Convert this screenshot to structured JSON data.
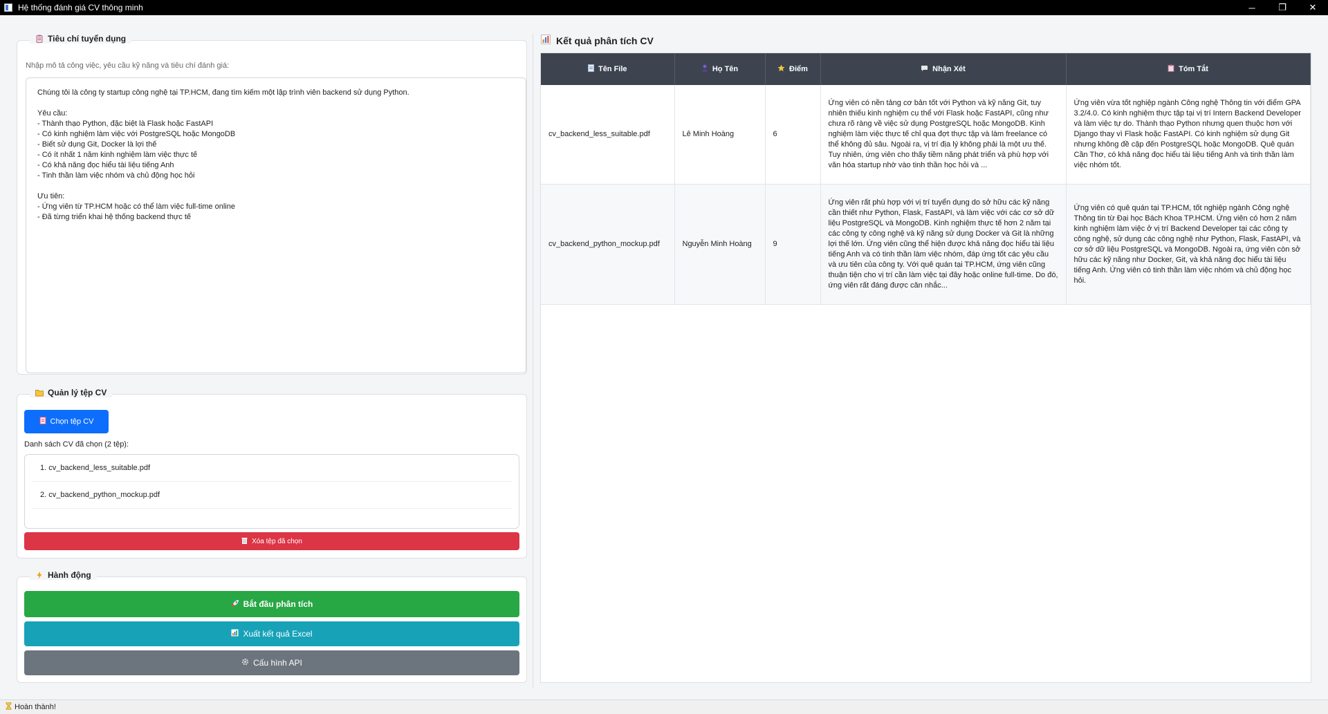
{
  "window": {
    "title": "Hệ thống đánh giá CV thông minh",
    "minimize": "─",
    "restore": "❐",
    "close": "✕"
  },
  "criteria": {
    "group_title": "Tiêu chí tuyển dụng",
    "hint": "Nhập mô tả công việc, yêu cầu kỹ năng và tiêu chí đánh giá:",
    "text": "Chúng tôi là công ty startup công nghệ tại TP.HCM, đang tìm kiếm một lập trình viên backend sử dụng Python.\n\nYêu cầu:\n- Thành thạo Python, đặc biệt là Flask hoặc FastAPI\n- Có kinh nghiệm làm việc với PostgreSQL hoặc MongoDB\n- Biết sử dụng Git, Docker là lợi thế\n- Có ít nhất 1 năm kinh nghiệm làm việc thực tế\n- Có khả năng đọc hiểu tài liệu tiếng Anh\n- Tinh thần làm việc nhóm và chủ động học hỏi\n\nƯu tiên:\n- Ứng viên từ TP.HCM hoặc có thể làm việc full-time online\n- Đã từng triển khai hệ thống backend thực tế"
  },
  "files": {
    "group_title": "Quản lý tệp CV",
    "choose_label": "Chọn tệp CV",
    "list_label": "Danh sách CV đã chọn (2 tệp):",
    "items": [
      "1. cv_backend_less_suitable.pdf",
      "2. cv_backend_python_mockup.pdf"
    ],
    "delete_label": "Xóa tệp đã chọn"
  },
  "actions": {
    "group_title": "Hành động",
    "start_label": "Bắt đầu phân tích",
    "export_label": "Xuất kết quả Excel",
    "config_label": "Cấu hình API"
  },
  "results": {
    "title": "Kết quả phân tích CV",
    "columns": [
      "Tên File",
      "Họ Tên",
      "Điểm",
      "Nhận Xét",
      "Tóm Tắt"
    ],
    "rows": [
      {
        "file": "cv_backend_less_suitable.pdf",
        "name": "Lê Minh Hoàng",
        "score": "6",
        "comment": "Ứng viên có nền tảng cơ bản tốt với Python và kỹ năng Git, tuy nhiên thiếu kinh nghiệm cụ thể với Flask hoặc FastAPI, cũng như chưa rõ ràng về việc sử dụng PostgreSQL hoặc MongoDB. Kinh nghiệm làm việc thực tế chỉ qua đợt thực tập và làm freelance có thể không đủ sâu. Ngoài ra, vị trí địa lý không phải là một ưu thế. Tuy nhiên, ứng viên cho thấy tiềm năng phát triển và phù hợp với văn hóa startup nhờ vào tinh thần học hỏi và ...",
        "summary": "Ứng viên vừa tốt nghiệp ngành Công nghệ Thông tin với điểm GPA 3.2/4.0. Có kinh nghiệm thực tập tại vị trí Intern Backend Developer và làm việc tự do. Thành thạo Python nhưng quen thuộc hơn với Django thay vì Flask hoặc FastAPI. Có kinh nghiệm sử dụng Git nhưng không đề cập đến PostgreSQL hoặc MongoDB. Quê quán Cần Thơ, có khả năng đọc hiểu tài liệu tiếng Anh và tinh thần làm việc nhóm tốt."
      },
      {
        "file": "cv_backend_python_mockup.pdf",
        "name": "Nguyễn Minh Hoàng",
        "score": "9",
        "comment": "Ứng viên rất phù hợp với vị trí tuyển dụng do sở hữu các kỹ năng cần thiết như Python, Flask, FastAPI, và làm việc với các cơ sở dữ liệu PostgreSQL và MongoDB. Kinh nghiệm thực tế hơn 2 năm tại các công ty công nghệ và kỹ năng sử dụng Docker và Git là những lợi thế lớn. Ứng viên cũng thể hiện được khả năng đọc hiểu tài liệu tiếng Anh và có tinh thần làm việc nhóm, đáp ứng tốt các yêu cầu và ưu tiên của công ty. Với quê quán tại TP.HCM, ứng viên cũng thuận tiện cho vị trí cần làm việc tại đây hoặc online full-time. Do đó, ứng viên rất đáng được cân nhắc...",
        "summary": "Ứng viên có quê quán tại TP.HCM, tốt nghiệp ngành Công nghệ Thông tin từ Đại học Bách Khoa TP.HCM. Ứng viên có hơn 2 năm kinh nghiệm làm việc ở vị trí Backend Developer tại các công ty công nghệ, sử dụng các công nghệ như Python, Flask, FastAPI, và cơ sở dữ liệu PostgreSQL và MongoDB. Ngoài ra, ứng viên còn sở hữu các kỹ năng như Docker, Git, và khả năng đọc hiểu tài liệu tiếng Anh. Ứng viên có tinh thần làm việc nhóm và chủ động học hỏi."
      }
    ]
  },
  "status": {
    "text": "Hoàn thành!"
  },
  "colors": {
    "primary": "#0d6efd",
    "danger": "#dc3545",
    "success": "#28a745",
    "info": "#17a2b8",
    "secondary": "#6c757d",
    "table_header": "#3d4450"
  },
  "icons": {
    "app": "app-window-icon",
    "criteria": "clipboard-icon",
    "files": "folder-icon",
    "actions": "lightning-icon",
    "results": "bar-chart-icon"
  }
}
